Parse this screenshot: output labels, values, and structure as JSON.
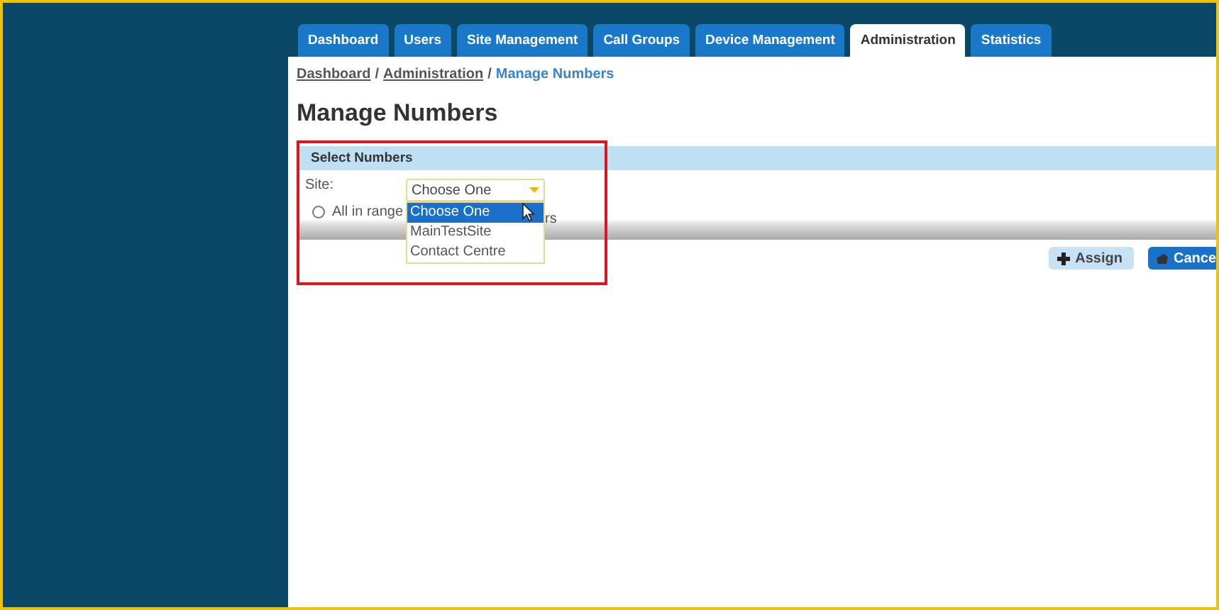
{
  "tabs": [
    {
      "label": "Dashboard",
      "selected": false
    },
    {
      "label": "Users",
      "selected": false
    },
    {
      "label": "Site Management",
      "selected": false
    },
    {
      "label": "Call Groups",
      "selected": false
    },
    {
      "label": "Device Management",
      "selected": false
    },
    {
      "label": "Administration",
      "selected": true
    },
    {
      "label": "Statistics",
      "selected": false
    }
  ],
  "breadcrumb": [
    {
      "label": "Dashboard",
      "kind": "link"
    },
    {
      "label": "/",
      "kind": "separator"
    },
    {
      "label": "Administration",
      "kind": "link"
    },
    {
      "label": "/",
      "kind": "separator"
    },
    {
      "label": "Manage Numbers",
      "kind": "current"
    }
  ],
  "page_title": "Manage Numbers",
  "panel": {
    "title": "Select Numbers",
    "site_label": "Site:",
    "site_select": {
      "value": "Choose One",
      "expanded": true,
      "options": [
        {
          "label": "Choose One",
          "selected": true
        },
        {
          "label": "MainTestSite",
          "selected": false
        },
        {
          "label": "Contact Centre",
          "selected": false
        }
      ]
    },
    "radio": {
      "label": "All in range",
      "checked": false
    },
    "radio_label_tail": "rs"
  },
  "buttons": [
    {
      "label": "Assign",
      "kind": "assign"
    },
    {
      "label": "Cance",
      "kind": "cancel"
    }
  ]
}
